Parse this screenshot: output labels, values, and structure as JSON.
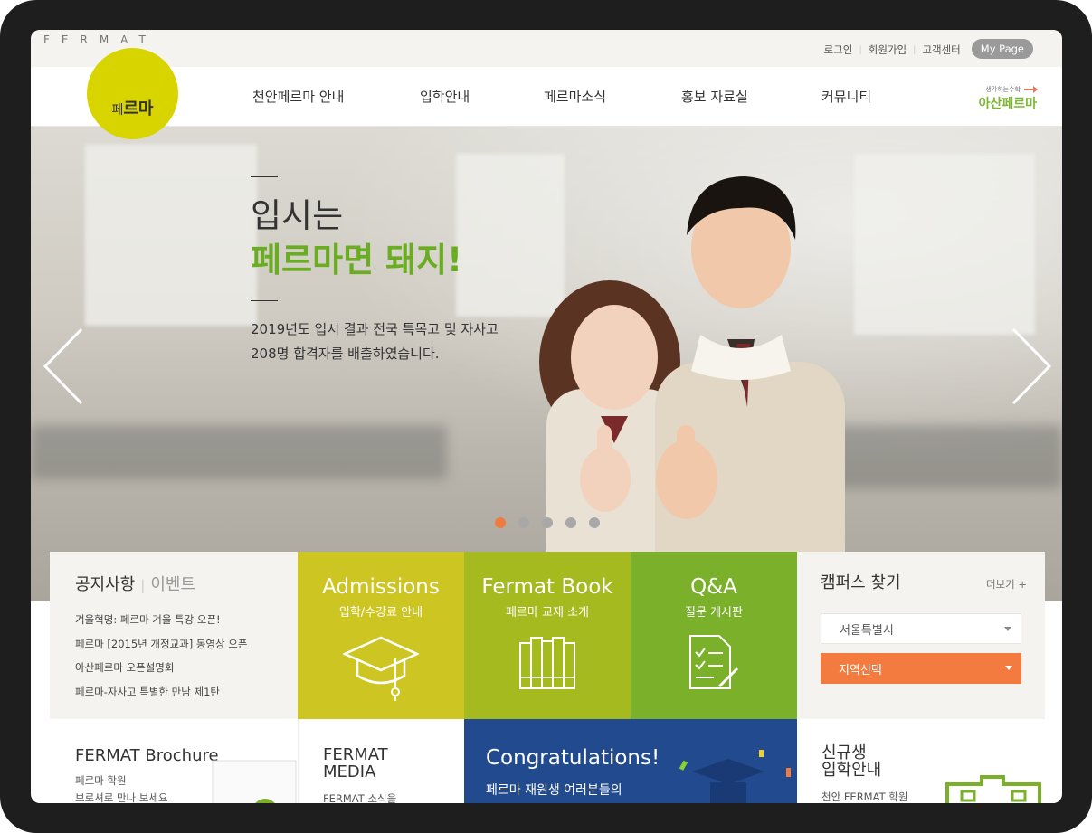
{
  "util": {
    "login": "로그인",
    "signup": "회원가입",
    "support": "고객센터",
    "mypage": "My Page"
  },
  "brand": {
    "wordmark": "FERMAT",
    "logo_text_a": "페",
    "logo_text_b": "르마"
  },
  "nav": {
    "items": [
      "천안페르마 안내",
      "입학안내",
      "페르마소식",
      "홍보 자료실",
      "커뮤니티"
    ],
    "asan_small": "생각하는수학",
    "asan_big": "아산페르마"
  },
  "hero": {
    "line1": "입시는",
    "line2": "페르마면 돼지!",
    "desc1": "2019년도 입시 결과 전국 특목고 및 자사고",
    "desc2": "208명 합격자를 배출하였습니다.",
    "dots_count": 5,
    "active_dot": 0
  },
  "notice": {
    "tab_active": "공지사항",
    "tab_inactive": "이벤트",
    "items": [
      "겨울혁명: 페르마 겨울 특강 오픈!",
      "페르마 [2015년 개정교과] 동영상 오픈",
      "아산페르마 오픈설명회",
      "페르마-자사고 특별한 만남 제1탄"
    ]
  },
  "tiles": [
    {
      "title": "Admissions",
      "subtitle": "입학/수강료 안내",
      "icon": "graduation-cap-icon",
      "color": "#cdc522"
    },
    {
      "title": "Fermat Book",
      "subtitle": "페르마 교재 소개",
      "icon": "books-icon",
      "color": "#a5ba1e"
    },
    {
      "title": "Q&A",
      "subtitle": "질문 게시판",
      "icon": "checklist-icon",
      "color": "#7bb02b"
    }
  ],
  "campus": {
    "title": "캠퍼스 찾기",
    "more": "더보기 +",
    "select_city": "서울특별시",
    "select_region": "지역선택"
  },
  "bottom": {
    "brochure_title": "FERMAT Brochure",
    "brochure_line1": "페르마 학원",
    "brochure_line2": "브로셔로 만나 보세요",
    "media_title1": "FERMAT",
    "media_title2": "MEDIA",
    "media_desc": "FERMAT 소식을",
    "congrats_title": "Congratulations!",
    "congrats_desc": "페르마 재원생 여러분들의",
    "new_title1": "신규생",
    "new_title2": "입학안내",
    "new_desc": "천안 FERMAT 학원"
  },
  "colors": {
    "accent_green": "#6aad22",
    "logo_yellow": "#d8d400",
    "orange": "#f47b3f",
    "navy": "#224a8e"
  }
}
